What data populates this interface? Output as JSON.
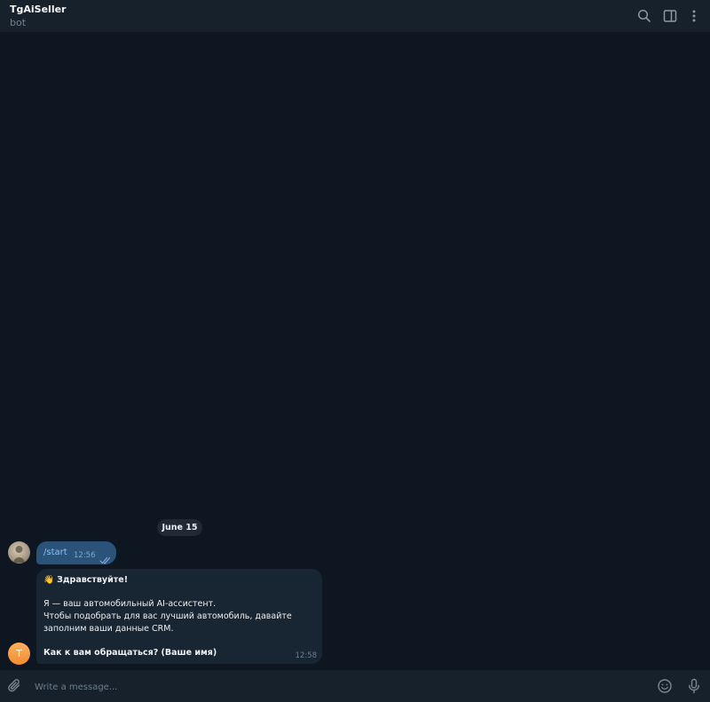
{
  "header": {
    "title": "TgAiSeller",
    "subtitle": "bot",
    "icons": [
      "search-icon",
      "sidebar-toggle-icon",
      "more-vertical-icon"
    ]
  },
  "date_separator": "June 15",
  "messages": {
    "outgoing": {
      "text": "/start",
      "time": "12:56",
      "status_icon": "double-check-icon"
    },
    "incoming": {
      "avatar_letter": "T",
      "greeting": "👋 Здравствуйте!",
      "line1": "Я — ваш автомобильный AI-ассистент.",
      "line2": "Чтобы подобрать для вас лучший автомобиль, давайте",
      "line3": "заполним ваши данные CRM.",
      "question": "Как к вам обращаться? (Ваше имя)",
      "time": "12:58"
    }
  },
  "composer": {
    "placeholder": "Write a message...",
    "icons": [
      "attach-icon",
      "emoji-icon",
      "microphone-icon"
    ]
  },
  "colors": {
    "background": "#0e1621",
    "header": "#17212b",
    "outgoing_bubble": "#2b5278",
    "incoming_bubble": "#182533",
    "bot_avatar": "#f18b33"
  }
}
